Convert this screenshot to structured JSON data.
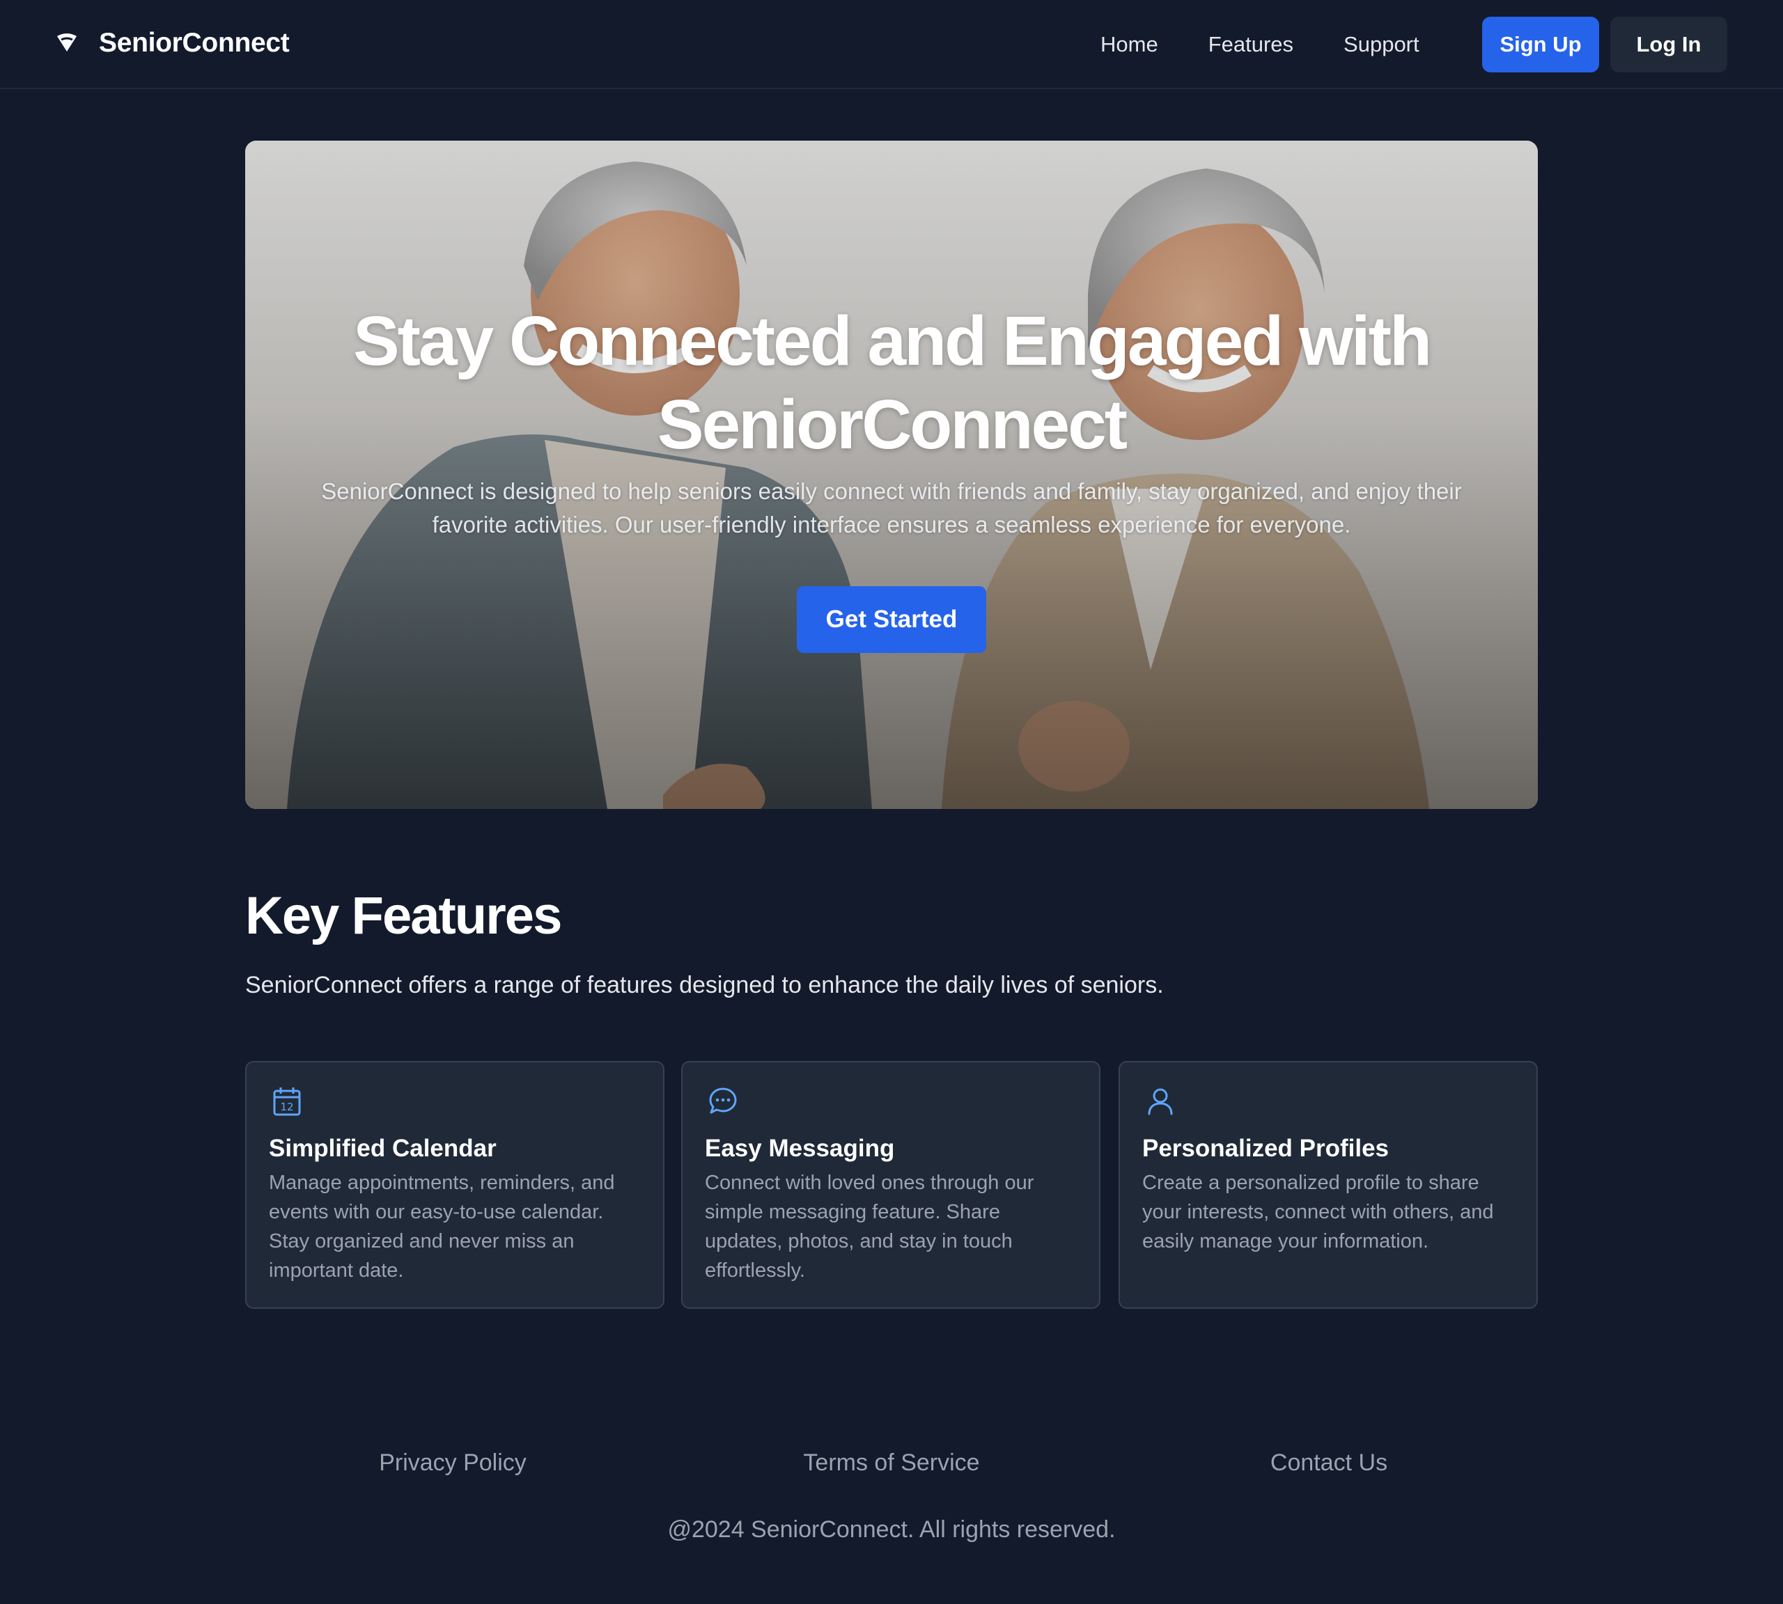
{
  "brand": {
    "name": "SeniorConnect",
    "icon": "wifi-signal-icon"
  },
  "nav": {
    "links": [
      "Home",
      "Features",
      "Support"
    ],
    "signup_label": "Sign Up",
    "login_label": "Log In"
  },
  "hero": {
    "title_line1": "Stay Connected and Engaged with",
    "title_line2": "SeniorConnect",
    "subtitle": "SeniorConnect is designed to help seniors easily connect with friends and family, stay organized, and enjoy their favorite activities. Our user-friendly interface ensures a seamless experience for everyone.",
    "cta_label": "Get Started"
  },
  "features": {
    "title": "Key Features",
    "subtitle": "SeniorConnect offers a range of features designed to enhance the daily lives of seniors.",
    "cards": [
      {
        "icon": "calendar-icon",
        "title": "Simplified Calendar",
        "description": "Manage appointments, reminders, and events with our easy-to-use calendar. Stay organized and never miss an important date."
      },
      {
        "icon": "chat-bubble-icon",
        "title": "Easy Messaging",
        "description": "Connect with loved ones through our simple messaging feature. Share updates, photos, and stay in touch effortlessly."
      },
      {
        "icon": "user-icon",
        "title": "Personalized Profiles",
        "description": "Create a personalized profile to share your interests, connect with others, and easily manage your information."
      }
    ]
  },
  "footer": {
    "links": [
      "Privacy Policy",
      "Terms of Service",
      "Contact Us"
    ],
    "copyright": "@2024 SeniorConnect. All rights reserved."
  },
  "colors": {
    "background": "#121a2c",
    "accent": "#2563eb",
    "card_bg": "#1f2937",
    "icon_blue": "#60a5fa"
  }
}
